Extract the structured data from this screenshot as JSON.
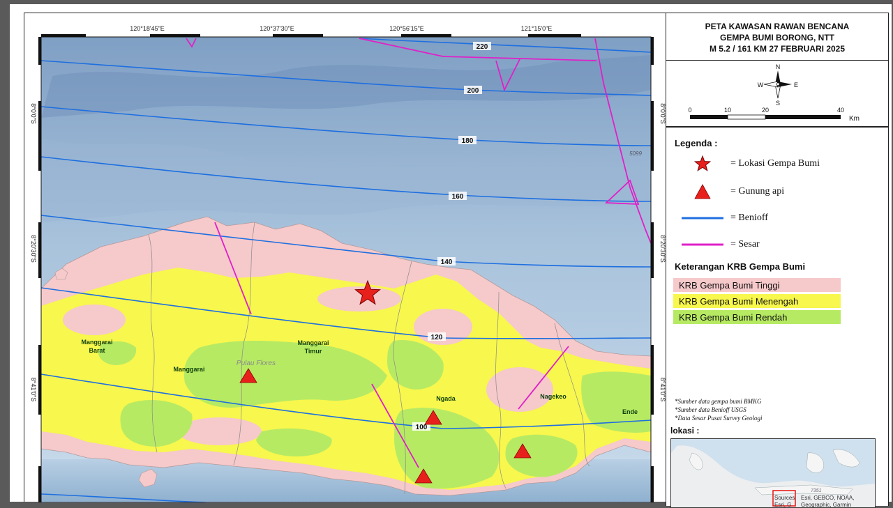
{
  "title": {
    "line1": "PETA KAWASAN RAWAN BENCANA",
    "line2": "GEMPA BUMI BORONG, NTT",
    "line3": "M 5.2 / 161 KM 27 FEBRUARI 2025"
  },
  "graticule": {
    "top_labels": [
      "120°18'45\"E",
      "120°37'30\"E",
      "120°56'15\"E",
      "121°15'0\"E"
    ],
    "side_labels": [
      "8°0'0\"S",
      "8°20'30\"S",
      "8°41'0\"S"
    ]
  },
  "compass": {
    "n": "N",
    "s": "S",
    "e": "E",
    "w": "W"
  },
  "scale_bar": {
    "ticks": [
      "0",
      "10",
      "20",
      "40"
    ],
    "unit": "Km"
  },
  "benioff_labels": [
    "220",
    "200",
    "180",
    "160",
    "140",
    "120",
    "100"
  ],
  "map_labels": {
    "manggarai_barat_1": "Manggarai",
    "manggarai_barat_2": "Barat",
    "manggarai": "Manggarai",
    "manggarai_timur_1": "Manggarai",
    "manggarai_timur_2": "Timur",
    "ngada": "Ngada",
    "nagekeo": "Nagekeo",
    "ende": "Ende",
    "pulau": "Pulau Flores",
    "depth": "5099"
  },
  "legend": {
    "title": "Legenda :",
    "items": [
      {
        "label": "= Lokasi Gempa Bumi",
        "icon": "star-icon"
      },
      {
        "label": "= Gunung api",
        "icon": "triangle-icon"
      },
      {
        "label": "= Benioff",
        "icon": "line-icon"
      },
      {
        "label": "= Sesar",
        "icon": "line-icon"
      }
    ],
    "krb_title": "Keterangan KRB Gempa Bumi",
    "krb": [
      {
        "label": "KRB Gempa Bumi Tinggi",
        "color": "#f6c9cb"
      },
      {
        "label": "KRB Gempa Bumi  Menengah",
        "color": "#f7f74d"
      },
      {
        "label": "KRB Gempa Bumi Rendah",
        "color": "#b7ea63"
      }
    ],
    "notes": [
      "*Sumber data gempa bumi BMKG",
      "*Sumber data Benioff USGS",
      "*Data Sesar Pusat Survey Geologi"
    ],
    "lokasi": "lokasi :"
  },
  "inset": {
    "attribution": "Esri, GEBCO, NOAA,",
    "attribution2": "Geographic, Garmin",
    "sources1": "Sources",
    "sources2": "Esri, G",
    "depth": "7351"
  },
  "colors": {
    "high": "#f6c9cb",
    "medium": "#f7f74d",
    "low": "#b7ea63",
    "benioff": "#1e6fe0",
    "fault": "#e020c8",
    "sea": "#8fb4d3",
    "marker": "#e8201c"
  }
}
